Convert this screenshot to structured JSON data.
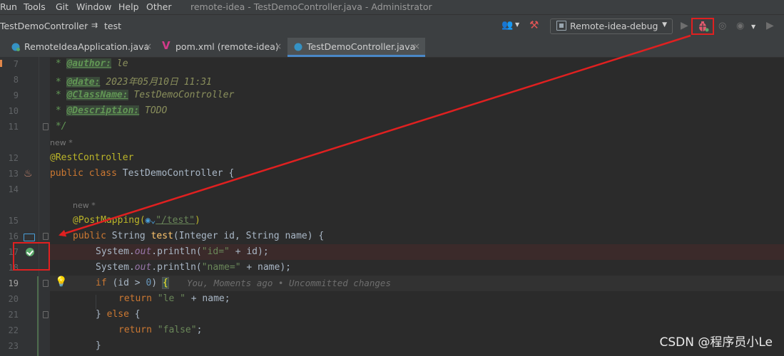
{
  "menu": [
    "Run",
    "Tools",
    "Git",
    "Window",
    "Help",
    "Other"
  ],
  "window_title": "remote-idea - TestDemoController.java - Administrator",
  "breadcrumb": {
    "class": "TestDemoController",
    "method": "test"
  },
  "run_config": {
    "name": "Remote-idea-debug"
  },
  "tabs": [
    {
      "label": "RemoteIdeaApplication.java",
      "close": "×"
    },
    {
      "label": "pom.xml (remote-idea)",
      "close": "×"
    },
    {
      "label": "TestDemoController.java",
      "close": "×"
    }
  ],
  "line_numbers": [
    "7",
    "8",
    "9",
    "10",
    "11",
    "12",
    "13",
    "14",
    "15",
    "16",
    "17",
    "18",
    "19",
    "20",
    "21",
    "22",
    "23"
  ],
  "code": {
    "l7": {
      "star": " * ",
      "tag": "@author:",
      "val": " le"
    },
    "l8": {
      "star": " * ",
      "tag": "@date:",
      "val": " 2023年05月10日 11:31"
    },
    "l9": {
      "star": " * ",
      "tag": "@ClassName:",
      "val": " TestDemoController"
    },
    "l10": {
      "star": " * ",
      "tag": "@Description:",
      "val": " TODO"
    },
    "l11": " */",
    "hint1": "new *",
    "l12": "@RestController",
    "l13a": "public class",
    "l13b": " TestDemoController {",
    "hint2": "new *",
    "l15a": "@PostMapping(",
    "l15b": "\"/test\"",
    "l15c": ")",
    "l16a": "public",
    "l16b": " String ",
    "l16c": "test",
    "l16d": "(Integer id, String name) {",
    "l17a": "System.",
    "l17b": "out",
    "l17c": ".println(",
    "l17d": "\"id=\"",
    "l17e": " + id);",
    "l18a": "System.",
    "l18b": "out",
    "l18c": ".println(",
    "l18d": "\"name=\"",
    "l18e": " + name);",
    "l19a": "if",
    "l19b": " (id > ",
    "l19c": "0",
    "l19d": ") ",
    "l19e": "{",
    "blame": "You, Moments ago • Uncommitted changes",
    "l20a": "return",
    "l20b": "\"le \"",
    "l20c": " + name;",
    "l21a": "} ",
    "l21b": "else",
    "l21c": " {",
    "l22a": "return",
    "l22b": "\"false\"",
    "l22c": ";",
    "l23": "}"
  },
  "watermark": "CSDN @程序员小Le",
  "colors": {
    "annotation_red": "#e02020",
    "breakpoint_green": "#59a869",
    "active_tab_underline": "#4a88c7"
  }
}
